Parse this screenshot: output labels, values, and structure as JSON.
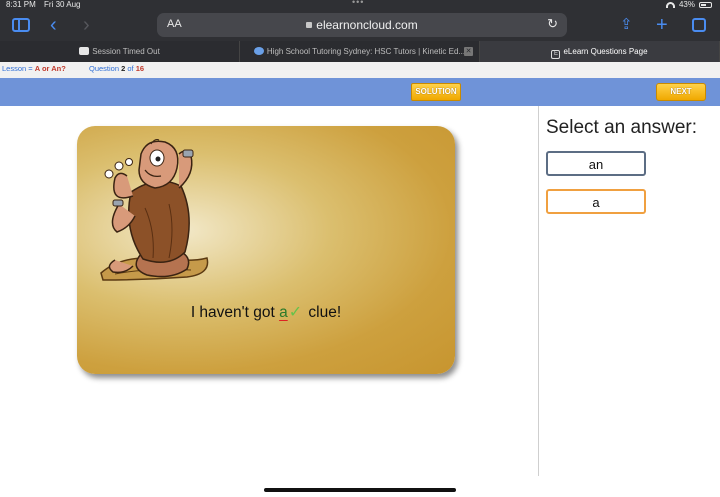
{
  "status_bar": {
    "time": "8:31 PM",
    "date": "Fri 30 Aug",
    "battery": "43%"
  },
  "browser": {
    "aa_label": "AA",
    "url": "elearnoncloud.com",
    "tabs": [
      {
        "label": "Session Timed Out"
      },
      {
        "label": "High School Tutoring Sydney: HSC Tutors | Kinetic Ed..."
      },
      {
        "label": "eLearn Questions Page"
      }
    ]
  },
  "lesson": {
    "lesson_label": "Lesson = ",
    "lesson_name": "A or An?",
    "question_label": "Question ",
    "question_num": "2",
    "of_label": " of ",
    "question_total": "16"
  },
  "actions": {
    "solution_label": "SOLUTION",
    "next_label": "NEXT"
  },
  "question": {
    "prefix": "I haven't got ",
    "answer": "a",
    "suffix": " clue!"
  },
  "answer_panel": {
    "title": "Select an answer:",
    "options": [
      "an",
      "a"
    ]
  },
  "colors": {
    "action_bar": "#6f93d8",
    "button": "#f0a800",
    "card": "#cda03e",
    "correct": "#66c24a"
  }
}
